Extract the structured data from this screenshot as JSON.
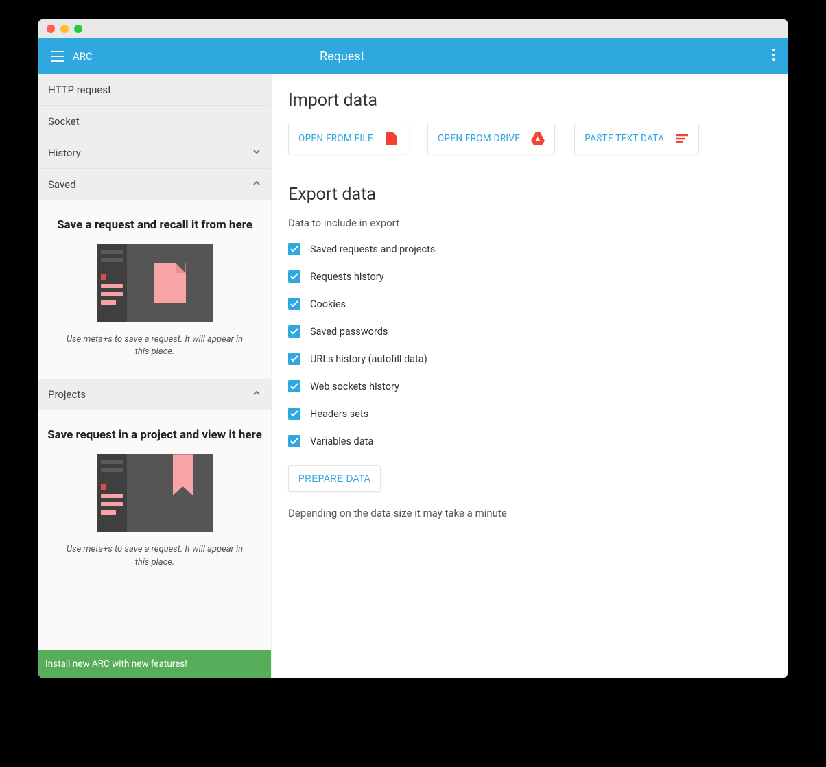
{
  "app": {
    "name": "ARC",
    "title": "Request"
  },
  "sidebar": {
    "items": [
      {
        "label": "HTTP request",
        "expandable": false
      },
      {
        "label": "Socket",
        "expandable": false
      },
      {
        "label": "History",
        "expandable": true,
        "expanded": false
      },
      {
        "label": "Saved",
        "expandable": true,
        "expanded": true
      }
    ],
    "saved_panel": {
      "heading": "Save a request and recall it from here",
      "note": "Use meta+s to save a request. It will appear in this place."
    },
    "projects_item": {
      "label": "Projects",
      "expanded": true
    },
    "projects_panel": {
      "heading": "Save request in a project and view it here",
      "note": "Use meta+s to save a request. It will appear in this place."
    },
    "banner": "Install new ARC with new features!"
  },
  "main": {
    "import": {
      "heading": "Import data",
      "buttons": [
        {
          "label": "OPEN FROM FILE",
          "icon": "file"
        },
        {
          "label": "OPEN FROM DRIVE",
          "icon": "drive"
        },
        {
          "label": "PASTE TEXT DATA",
          "icon": "notes"
        }
      ]
    },
    "export": {
      "heading": "Export data",
      "subtitle": "Data to include in export",
      "checks": [
        {
          "label": "Saved requests and projects",
          "checked": true
        },
        {
          "label": "Requests history",
          "checked": true
        },
        {
          "label": "Cookies",
          "checked": true
        },
        {
          "label": "Saved passwords",
          "checked": true
        },
        {
          "label": "URLs history (autofill data)",
          "checked": true
        },
        {
          "label": "Web sockets history",
          "checked": true
        },
        {
          "label": "Headers sets",
          "checked": true
        },
        {
          "label": "Variables data",
          "checked": true
        }
      ],
      "prepare_label": "PREPARE DATA",
      "footnote": "Depending on the data size it may take a minute"
    }
  }
}
